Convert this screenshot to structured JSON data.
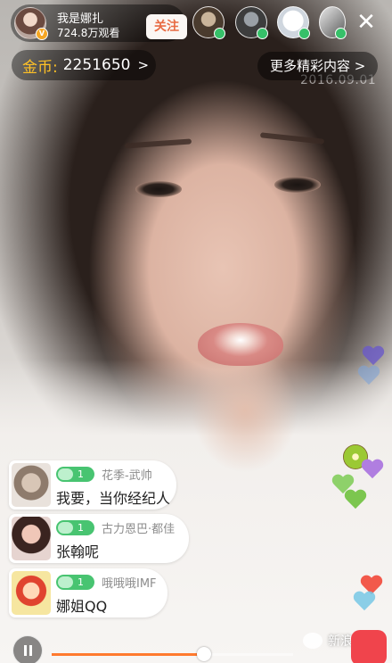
{
  "host": {
    "name": "我是娜扎",
    "viewers": "724.8万观看",
    "follow_label": "关注"
  },
  "close_label": "✕",
  "coins": {
    "label": "金币:",
    "value": "2251650",
    "arrow": ">"
  },
  "more_content": "更多精彩内容 >",
  "watermark_date": "2016.09.01",
  "comments": [
    {
      "level": "1",
      "user": "花季-武帅",
      "text": "我要，当你经纪人"
    },
    {
      "level": "1",
      "user": "古力恩巴·都佳",
      "text": "张翰呢"
    },
    {
      "level": "1",
      "user": "哦哦哦IMF",
      "text": "娜姐QQ"
    }
  ],
  "source_watermark": "新浪娱乐",
  "colors": {
    "accent": "#ff7a2e",
    "coin": "#ffc126",
    "follow_text": "#e86b43",
    "level_badge": "#48c471",
    "gift": "#f0444c"
  },
  "icons": [
    "pause-icon",
    "share-icon",
    "gift-icon",
    "close-icon",
    "heart-icon",
    "wechat-icon"
  ]
}
